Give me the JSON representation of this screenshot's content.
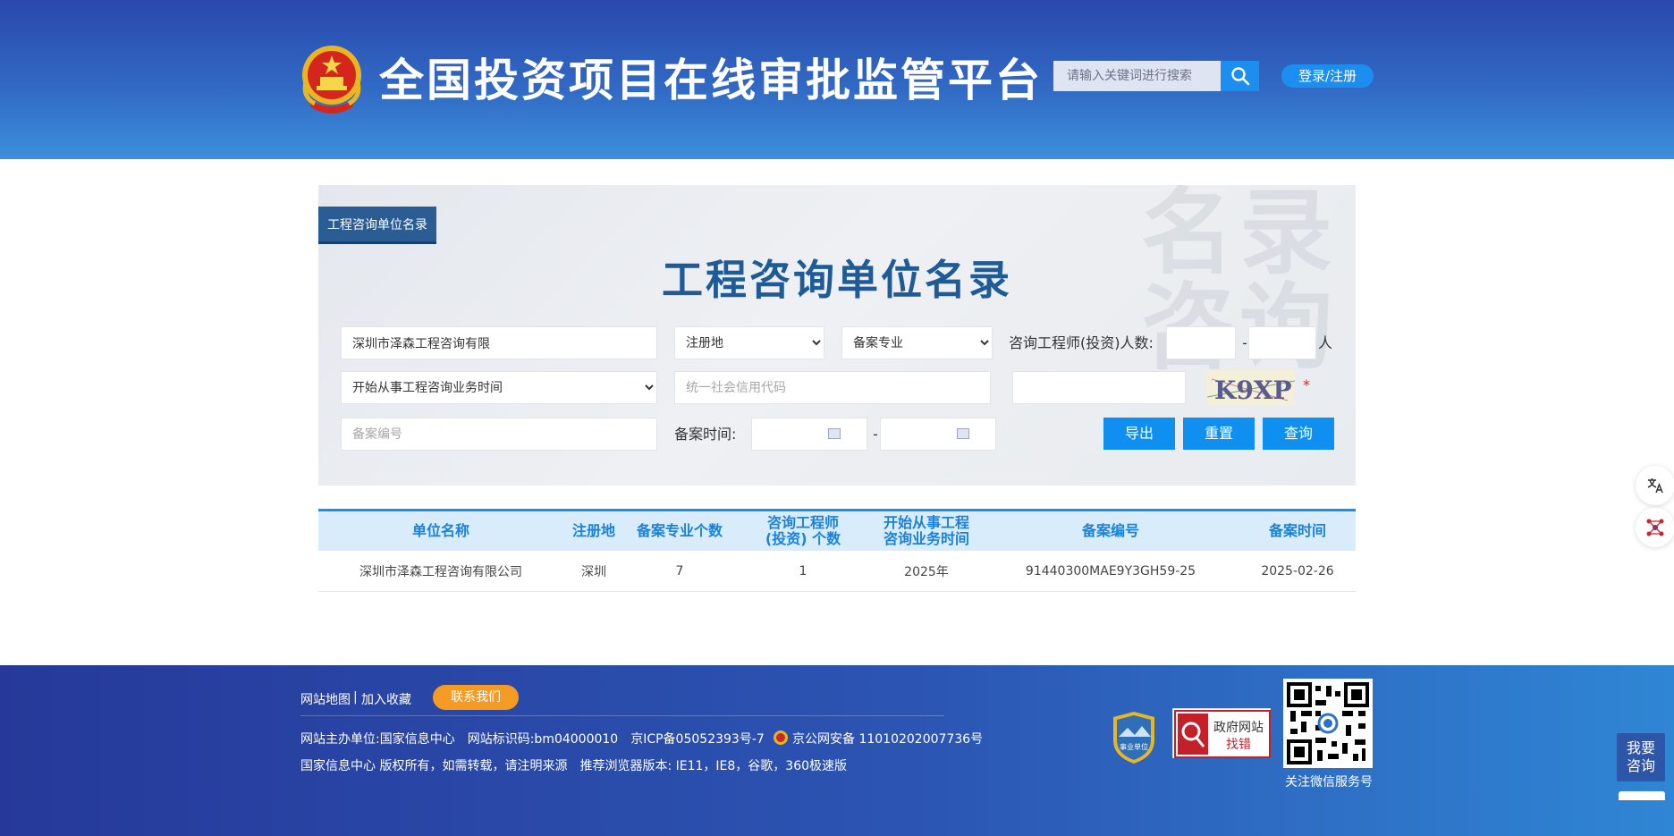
{
  "header": {
    "site_title": "全国投资项目在线审批监管平台",
    "search_placeholder": "请输入关键词进行搜索",
    "login_label": "登录/注册"
  },
  "panel": {
    "tag_label": "工程咨询单位名录",
    "title": "工程咨询单位名录",
    "watermark": "名录\n咨询",
    "unit_name_value": "深圳市泽森工程咨询有限",
    "region_select": "注册地",
    "specialty_select": "备案专业",
    "engineer_count_label": "咨询工程师(投资)人数:",
    "range_dash": "-",
    "person_unit": "人",
    "start_time_select": "开始从事工程咨询业务时间",
    "credit_code_placeholder": "统一社会信用代码",
    "captcha_text": "K9XP",
    "required_mark": "*",
    "record_no_placeholder": "备案编号",
    "record_time_label": "备案时间:",
    "export_label": "导出",
    "reset_label": "重置",
    "query_label": "查询"
  },
  "table": {
    "headers": [
      "单位名称",
      "注册地",
      "备案专业个数",
      "咨询工程师\n(投资) 个数",
      "开始从事工程\n咨询业务时间",
      "备案编号",
      "备案时间"
    ],
    "rows": [
      [
        "深圳市泽森工程咨询有限公司",
        "深圳",
        "7",
        "1",
        "2025年",
        "91440300MAE9Y3GH59-25",
        "2025-02-26"
      ]
    ]
  },
  "footer": {
    "sitemap_label": "网站地图",
    "separator": "|",
    "bookmark_label": "加入收藏",
    "contact_label": "联系我们",
    "line1": "网站主办单位:国家信息中心　网站标识码:bm04000010　京ICP备05052393号-7",
    "police_record": "京公网安备 11010202007736号",
    "line2": "国家信息中心 版权所有，如需转载，请注明来源　推荐浏览器版本: IE11，IE8，谷歌，360极速版",
    "badge_text": "事业单位",
    "finder_line1": "政府网站",
    "finder_line2": "找错",
    "qr_caption": "关注微信服务号"
  },
  "floating": {
    "consult_label": "我要\n咨询"
  },
  "colors": {
    "header_blue": "#2a49ad",
    "accent_blue": "#1c8ef0",
    "title_blue": "#1f5b96",
    "contact_orange": "#f59a23"
  }
}
